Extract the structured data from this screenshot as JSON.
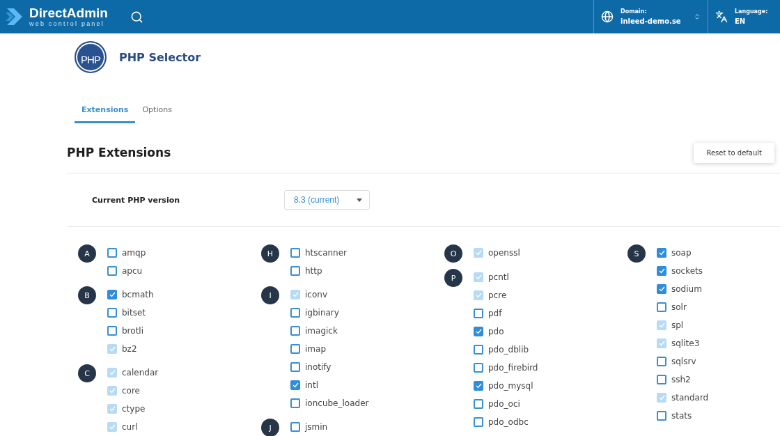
{
  "header": {
    "brand": "DirectAdmin",
    "tagline": "web control panel",
    "domain": {
      "label": "Domain:",
      "value": "inleed-demo.se"
    },
    "language": {
      "label": "Language:",
      "value": "EN"
    }
  },
  "page": {
    "logo_text": "PHP",
    "title": "PHP Selector"
  },
  "tabs": [
    {
      "label": "Extensions",
      "selected": true
    },
    {
      "label": "Options",
      "selected": false
    }
  ],
  "section": {
    "title": "PHP Extensions",
    "reset_button": "Reset to default",
    "version_label": "Current PHP version",
    "version_value": "8.3 (current)"
  },
  "columns": [
    {
      "groups": [
        {
          "letter": "A",
          "items": [
            {
              "label": "amqp",
              "checked": false,
              "disabled": false
            },
            {
              "label": "apcu",
              "checked": false,
              "disabled": false
            }
          ]
        },
        {
          "letter": "B",
          "items": [
            {
              "label": "bcmath",
              "checked": true,
              "disabled": false
            },
            {
              "label": "bitset",
              "checked": false,
              "disabled": false
            },
            {
              "label": "brotli",
              "checked": false,
              "disabled": false
            },
            {
              "label": "bz2",
              "checked": true,
              "disabled": true
            }
          ]
        },
        {
          "letter": "C",
          "items": [
            {
              "label": "calendar",
              "checked": true,
              "disabled": true
            },
            {
              "label": "core",
              "checked": true,
              "disabled": true
            },
            {
              "label": "ctype",
              "checked": true,
              "disabled": true
            },
            {
              "label": "curl",
              "checked": true,
              "disabled": true
            }
          ]
        }
      ]
    },
    {
      "groups": [
        {
          "letter": "H",
          "items": [
            {
              "label": "htscanner",
              "checked": false,
              "disabled": false
            },
            {
              "label": "http",
              "checked": false,
              "disabled": false
            }
          ]
        },
        {
          "letter": "I",
          "items": [
            {
              "label": "iconv",
              "checked": true,
              "disabled": true
            },
            {
              "label": "igbinary",
              "checked": false,
              "disabled": false
            },
            {
              "label": "imagick",
              "checked": false,
              "disabled": false
            },
            {
              "label": "imap",
              "checked": false,
              "disabled": false
            },
            {
              "label": "inotify",
              "checked": false,
              "disabled": false
            },
            {
              "label": "intl",
              "checked": true,
              "disabled": false
            },
            {
              "label": "ioncube_loader",
              "checked": false,
              "disabled": false
            }
          ]
        },
        {
          "letter": "J",
          "items": [
            {
              "label": "jsmin",
              "checked": false,
              "disabled": false
            }
          ]
        }
      ]
    },
    {
      "groups": [
        {
          "letter": "O",
          "items": [
            {
              "label": "openssl",
              "checked": true,
              "disabled": true
            }
          ]
        },
        {
          "letter": "P",
          "items": [
            {
              "label": "pcntl",
              "checked": true,
              "disabled": true
            },
            {
              "label": "pcre",
              "checked": true,
              "disabled": true
            },
            {
              "label": "pdf",
              "checked": false,
              "disabled": false
            },
            {
              "label": "pdo",
              "checked": true,
              "disabled": false
            },
            {
              "label": "pdo_dblib",
              "checked": false,
              "disabled": false
            },
            {
              "label": "pdo_firebird",
              "checked": false,
              "disabled": false
            },
            {
              "label": "pdo_mysql",
              "checked": true,
              "disabled": false
            },
            {
              "label": "pdo_oci",
              "checked": false,
              "disabled": false
            },
            {
              "label": "pdo_odbc",
              "checked": false,
              "disabled": false
            }
          ]
        }
      ]
    },
    {
      "groups": [
        {
          "letter": "S",
          "items": [
            {
              "label": "soap",
              "checked": true,
              "disabled": false
            },
            {
              "label": "sockets",
              "checked": true,
              "disabled": false
            },
            {
              "label": "sodium",
              "checked": true,
              "disabled": false
            },
            {
              "label": "solr",
              "checked": false,
              "disabled": false
            },
            {
              "label": "spl",
              "checked": true,
              "disabled": true
            },
            {
              "label": "sqlite3",
              "checked": true,
              "disabled": true
            },
            {
              "label": "sqlsrv",
              "checked": false,
              "disabled": false
            },
            {
              "label": "ssh2",
              "checked": false,
              "disabled": false
            },
            {
              "label": "standard",
              "checked": true,
              "disabled": true
            },
            {
              "label": "stats",
              "checked": false,
              "disabled": false
            }
          ]
        }
      ]
    }
  ]
}
